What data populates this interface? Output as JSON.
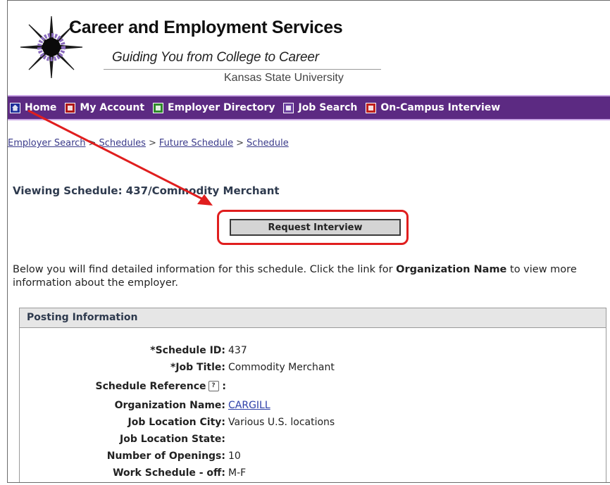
{
  "header": {
    "title": "Career and Employment Services",
    "tagline": "Guiding You from College to Career",
    "university": "Kansas State University"
  },
  "nav": {
    "items": [
      {
        "label": "Home",
        "icon": "home-icon"
      },
      {
        "label": "My Account",
        "icon": "account-icon"
      },
      {
        "label": "Employer Directory",
        "icon": "directory-icon"
      },
      {
        "label": "Job Search",
        "icon": "job-search-icon"
      },
      {
        "label": "On-Campus Interview",
        "icon": "interview-icon"
      }
    ]
  },
  "breadcrumb": {
    "items": [
      "Employer Search",
      "Schedules",
      "Future Schedule",
      "Schedule"
    ],
    "separator": ">"
  },
  "page": {
    "title": "Viewing Schedule: 437/Commodity Merchant",
    "request_button": "Request Interview",
    "intro_before": "Below you will find detailed information for this schedule. Click the link for ",
    "intro_bold": "Organization Name",
    "intro_after": " to view more information about the employer."
  },
  "posting": {
    "header": "Posting Information",
    "fields": [
      {
        "label": "*Schedule ID:",
        "value": "437"
      },
      {
        "label": "*Job Title:",
        "value": "Commodity Merchant"
      },
      {
        "label": "Schedule Reference",
        "value": ""
      },
      {
        "label": "Organization Name:",
        "value": "CARGILL"
      },
      {
        "label": "Job Location City:",
        "value": "Various U.S. locations"
      },
      {
        "label": "Job Location State:",
        "value": ""
      },
      {
        "label": "Number of Openings:",
        "value": "10"
      },
      {
        "label": "Work Schedule - off:",
        "value": "M-F"
      }
    ]
  },
  "colors": {
    "nav_bg": "#5c2a82",
    "highlight": "#e01e1e",
    "link": "#2d3fa8"
  }
}
